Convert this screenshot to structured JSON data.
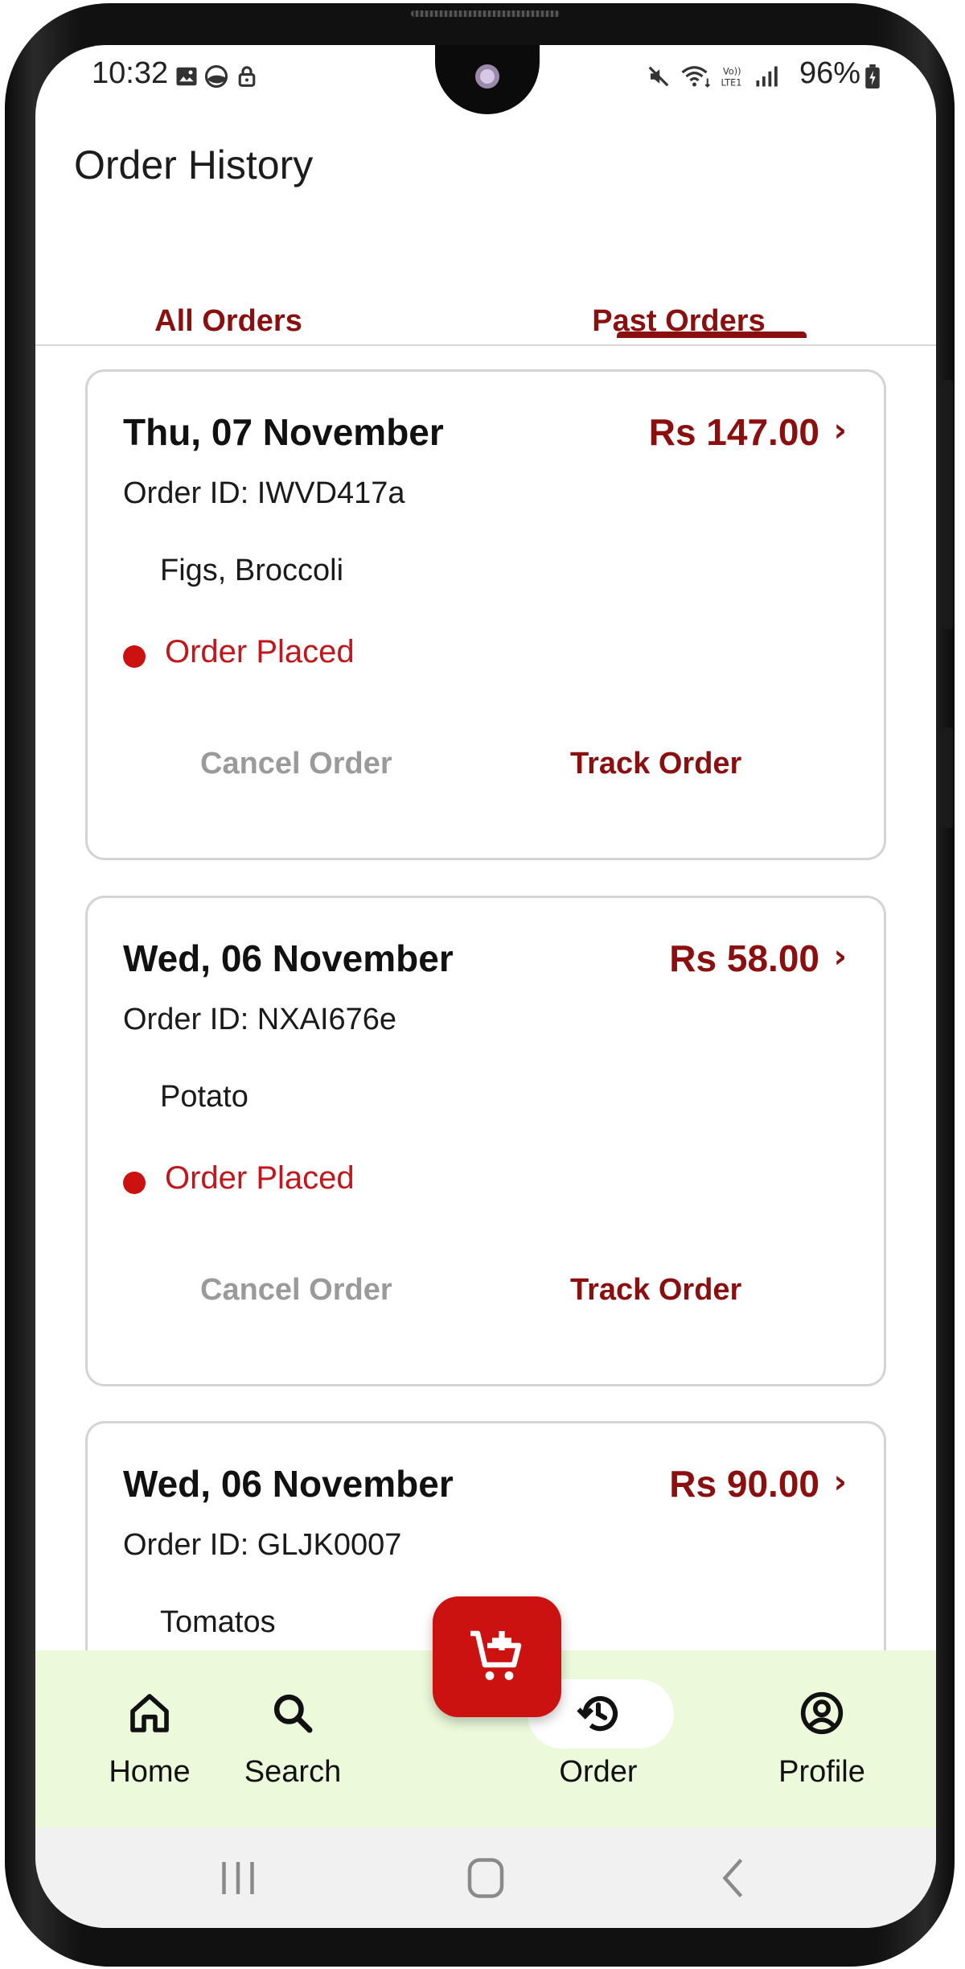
{
  "status_bar": {
    "time": "10:32",
    "battery": "96%"
  },
  "header": {
    "title": "Order History"
  },
  "tabs": [
    {
      "label": "All Orders",
      "active": false
    },
    {
      "label": "Past Orders",
      "active": true
    }
  ],
  "orders": [
    {
      "date": "Thu, 07 November",
      "price": "Rs 147.00",
      "order_id": "Order ID: IWVD417a",
      "items": "Figs, Broccoli",
      "status": "Order Placed",
      "cancel_label": "Cancel Order",
      "track_label": "Track Order"
    },
    {
      "date": "Wed, 06 November",
      "price": "Rs 58.00",
      "order_id": "Order ID: NXAI676e",
      "items": "Potato",
      "status": "Order Placed",
      "cancel_label": "Cancel Order",
      "track_label": "Track Order"
    },
    {
      "date": "Wed, 06 November",
      "price": "Rs 90.00",
      "order_id": "Order ID: GLJK0007",
      "items": "Tomatos"
    }
  ],
  "bottom_nav": [
    {
      "label": "Home",
      "icon": "home-icon"
    },
    {
      "label": "Search",
      "icon": "search-icon"
    },
    {
      "label": "Order",
      "icon": "history-icon",
      "active": true
    },
    {
      "label": "Profile",
      "icon": "profile-icon"
    }
  ],
  "fab": {
    "icon": "add-to-cart-icon"
  },
  "colors": {
    "accent": "#8b0f0f",
    "status_red": "#c0161c",
    "fab_red": "#cc1111",
    "nav_bg": "#ecfadb",
    "muted": "#9a9a9a"
  }
}
